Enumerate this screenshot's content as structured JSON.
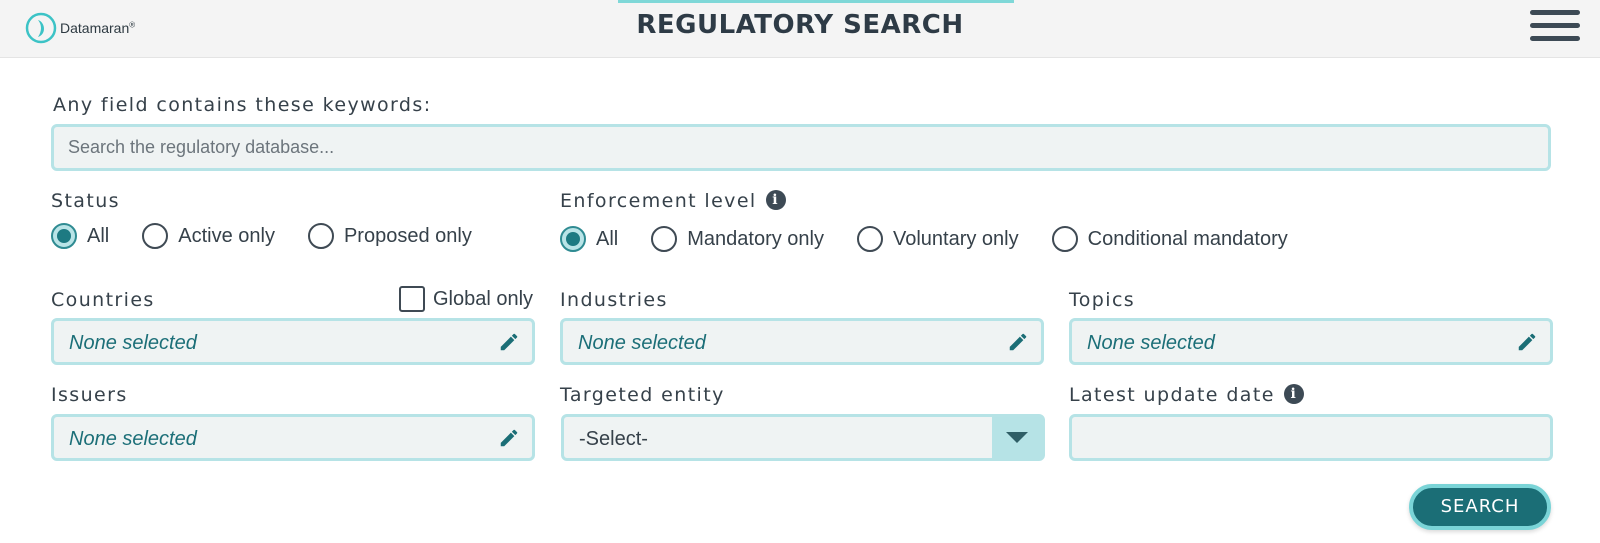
{
  "header": {
    "brand": "Datamaran",
    "brand_mark": "®",
    "title": "REGULATORY SEARCH",
    "menu_icon": "hamburger-menu-icon"
  },
  "keywords": {
    "label": "Any field contains these keywords:",
    "placeholder": "Search the regulatory database..."
  },
  "status": {
    "label": "Status",
    "options": [
      "All",
      "Active only",
      "Proposed only"
    ],
    "selected": "All"
  },
  "enforcement": {
    "label": "Enforcement level",
    "info_icon": "info-icon",
    "options": [
      "All",
      "Mandatory only",
      "Voluntary only",
      "Conditional mandatory"
    ],
    "selected": "All"
  },
  "countries": {
    "label": "Countries",
    "global_only_label": "Global only",
    "value": "None selected"
  },
  "industries": {
    "label": "Industries",
    "value": "None selected"
  },
  "topics": {
    "label": "Topics",
    "value": "None selected"
  },
  "issuers": {
    "label": "Issuers",
    "value": "None selected"
  },
  "targeted_entity": {
    "label": "Targeted entity",
    "value": "-Select-"
  },
  "latest_update": {
    "label": "Latest update date",
    "info_icon": "info-icon",
    "value": ""
  },
  "actions": {
    "search_label": "SEARCH"
  },
  "colors": {
    "accent": "#1b6e76",
    "field_border": "#b6e3e6",
    "field_bg": "#eff3f3",
    "text": "#36414a"
  }
}
